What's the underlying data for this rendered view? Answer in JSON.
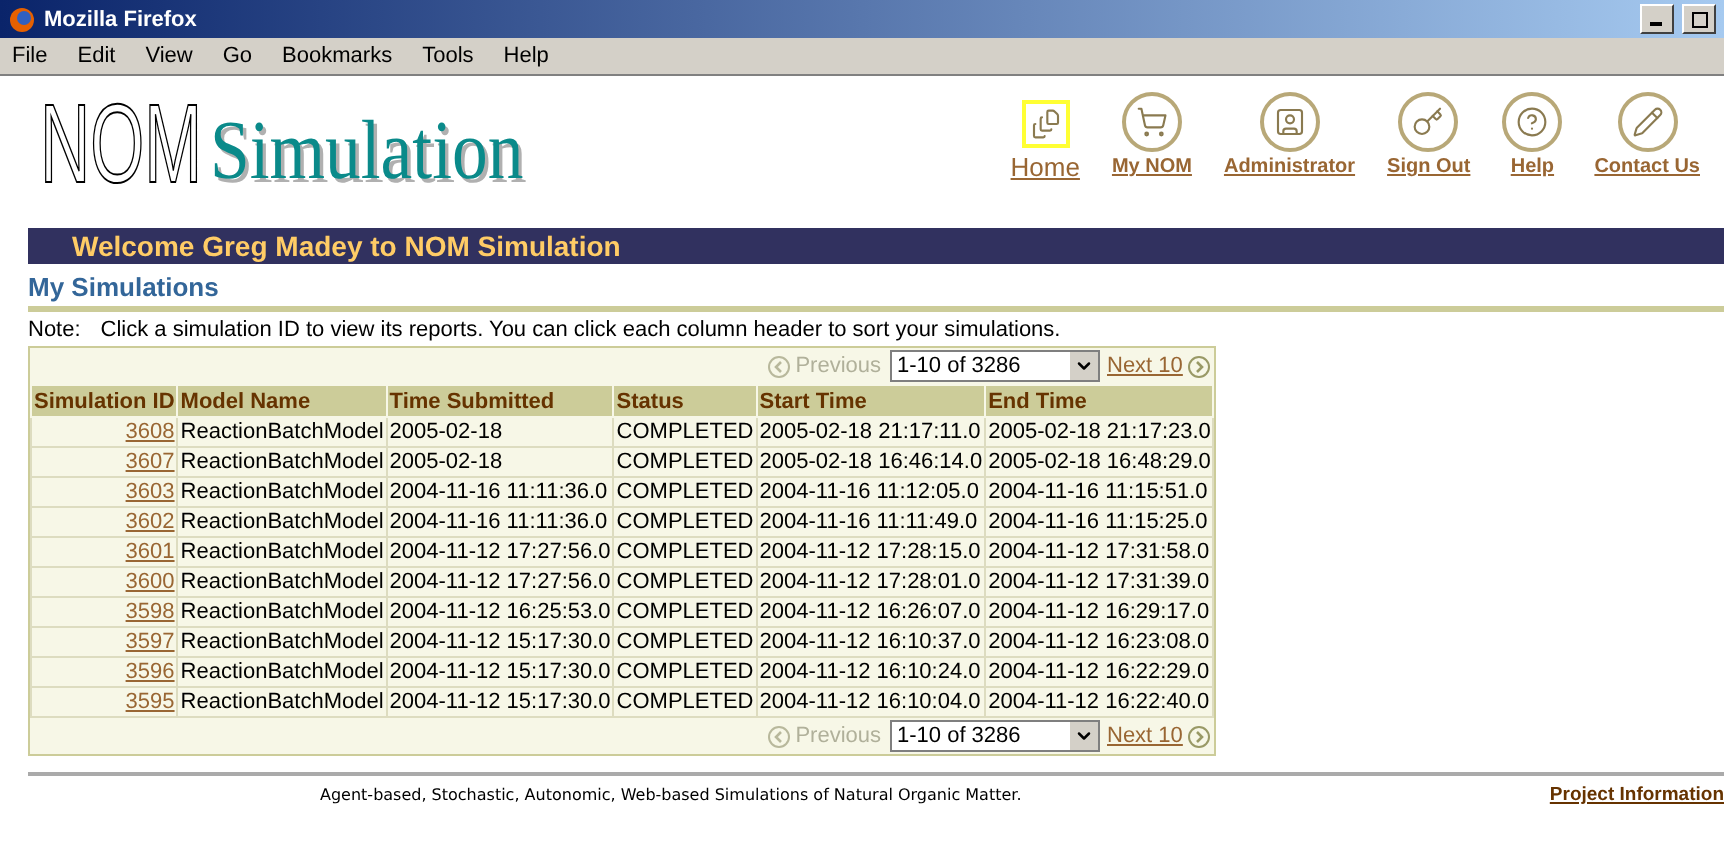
{
  "window": {
    "title": "Mozilla Firefox"
  },
  "menu": [
    "File",
    "Edit",
    "View",
    "Go",
    "Bookmarks",
    "Tools",
    "Help"
  ],
  "logo": {
    "outline": "NOM",
    "text": "Simulation"
  },
  "nav": [
    {
      "label": "Home",
      "kind": "home",
      "selected": true
    },
    {
      "label": "My NOM",
      "kind": "cart",
      "selected": false
    },
    {
      "label": "Administrator",
      "kind": "admin",
      "selected": false
    },
    {
      "label": "Sign Out",
      "kind": "key",
      "selected": false
    },
    {
      "label": "Help",
      "kind": "help",
      "selected": false
    },
    {
      "label": "Contact Us",
      "kind": "contact",
      "selected": false
    }
  ],
  "welcome": "Welcome Greg Madey to NOM Simulation",
  "section_title": "My Simulations",
  "note": {
    "label": "Note:",
    "text": "Click a simulation ID to view its reports. You can click each column header to sort your simulations."
  },
  "table": {
    "pager_top": {
      "previous": {
        "label": "Previous",
        "disabled": true
      },
      "range": "1-10 of 3286",
      "next": {
        "label": "Next 10",
        "disabled": false
      }
    },
    "columns": [
      "Simulation ID",
      "Model Name",
      "Time Submitted",
      "Status",
      "Start Time",
      "End Time"
    ],
    "rows": [
      [
        "3608",
        "ReactionBatchModel",
        "2005-02-18",
        "COMPLETED",
        "2005-02-18 21:17:11.0",
        "2005-02-18 21:17:23.0"
      ],
      [
        "3607",
        "ReactionBatchModel",
        "2005-02-18",
        "COMPLETED",
        "2005-02-18 16:46:14.0",
        "2005-02-18 16:48:29.0"
      ],
      [
        "3603",
        "ReactionBatchModel",
        "2004-11-16 11:11:36.0",
        "COMPLETED",
        "2004-11-16 11:12:05.0",
        "2004-11-16 11:15:51.0"
      ],
      [
        "3602",
        "ReactionBatchModel",
        "2004-11-16 11:11:36.0",
        "COMPLETED",
        "2004-11-16 11:11:49.0",
        "2004-11-16 11:15:25.0"
      ],
      [
        "3601",
        "ReactionBatchModel",
        "2004-11-12 17:27:56.0",
        "COMPLETED",
        "2004-11-12 17:28:15.0",
        "2004-11-12 17:31:58.0"
      ],
      [
        "3600",
        "ReactionBatchModel",
        "2004-11-12 17:27:56.0",
        "COMPLETED",
        "2004-11-12 17:28:01.0",
        "2004-11-12 17:31:39.0"
      ],
      [
        "3598",
        "ReactionBatchModel",
        "2004-11-12 16:25:53.0",
        "COMPLETED",
        "2004-11-12 16:26:07.0",
        "2004-11-12 16:29:17.0"
      ],
      [
        "3597",
        "ReactionBatchModel",
        "2004-11-12 15:17:30.0",
        "COMPLETED",
        "2004-11-12 16:10:37.0",
        "2004-11-12 16:23:08.0"
      ],
      [
        "3596",
        "ReactionBatchModel",
        "2004-11-12 15:17:30.0",
        "COMPLETED",
        "2004-11-12 16:10:24.0",
        "2004-11-12 16:22:29.0"
      ],
      [
        "3595",
        "ReactionBatchModel",
        "2004-11-12 15:17:30.0",
        "COMPLETED",
        "2004-11-12 16:10:04.0",
        "2004-11-12 16:22:40.0"
      ]
    ],
    "pager_bottom": {
      "previous": {
        "label": "Previous",
        "disabled": true
      },
      "range": "1-10 of 3286",
      "next": {
        "label": "Next 10",
        "disabled": false
      }
    }
  },
  "footer": {
    "text": "Agent-based, Stochastic, Autonomic, Web-based Simulations of Natural Organic Matter.",
    "link": "Project Information"
  }
}
